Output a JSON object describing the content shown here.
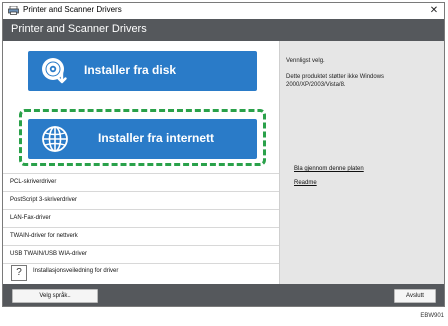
{
  "window": {
    "title": "Printer and Scanner Drivers",
    "close_glyph": "✕"
  },
  "header": {
    "title": "Printer and Scanner Drivers"
  },
  "main": {
    "install_disk_label": "Installer fra disk",
    "install_internet_label": "Installer fra internett",
    "list_items": [
      "PCL-skriverdriver",
      "PostScript 3-skriverdriver",
      "LAN-Fax-driver",
      "TWAIN-driver for nettverk",
      "USB TWAIN/USB WIA-driver"
    ],
    "help_glyph": "?",
    "help_label": "Installasjonsveiledning for driver"
  },
  "info_panel": {
    "prompt": "Vennligst velg.",
    "note": "Dette produktet støtter ikke Windows 2000/XP/2003/Vista/8.",
    "browse_link": "Bla gjennom denne platen",
    "readme_link": "Readme"
  },
  "footer": {
    "language_button": "Velg språk..",
    "exit_button": "Avslutt",
    "figure_code": "EBW901"
  },
  "colors": {
    "accent_blue": "#2a7bc8",
    "header_gray": "#55585c",
    "highlight_green": "#2aa14a"
  },
  "icons": {
    "disk": "disc-download-icon",
    "internet": "globe-icon",
    "app": "printer-icon"
  }
}
